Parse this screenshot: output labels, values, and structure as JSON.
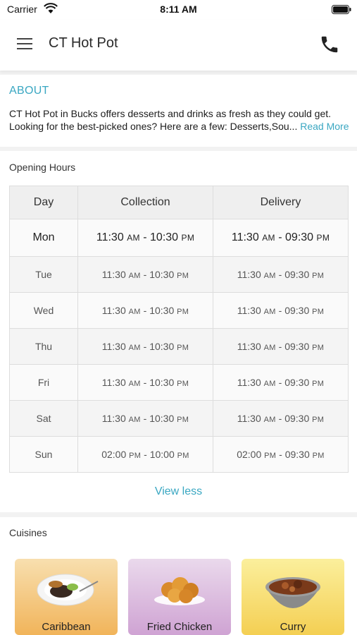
{
  "status_bar": {
    "carrier": "Carrier",
    "time": "8:11 AM"
  },
  "header": {
    "title": "CT Hot Pot",
    "menu_icon": "hamburger-menu-icon",
    "phone_icon": "phone-icon"
  },
  "about": {
    "title": "ABOUT",
    "text": "CT Hot Pot in Bucks offers desserts and drinks as fresh as they could get. Looking for the best-picked ones? Here are a few: Desserts,Sou...",
    "read_more": " Read More"
  },
  "opening_hours": {
    "title": "Opening Hours",
    "headers": {
      "day": "Day",
      "collection": "Collection",
      "delivery": "Delivery"
    },
    "rows": [
      {
        "day": "Mon",
        "collection": {
          "open": "11:30",
          "open_period": "AM",
          "close": "10:30",
          "close_period": "PM"
        },
        "delivery": {
          "open": "11:30",
          "open_period": "AM",
          "close": "09:30",
          "close_period": "PM"
        }
      },
      {
        "day": "Tue",
        "collection": {
          "open": "11:30",
          "open_period": "AM",
          "close": "10:30",
          "close_period": "PM"
        },
        "delivery": {
          "open": "11:30",
          "open_period": "AM",
          "close": "09:30",
          "close_period": "PM"
        }
      },
      {
        "day": "Wed",
        "collection": {
          "open": "11:30",
          "open_period": "AM",
          "close": "10:30",
          "close_period": "PM"
        },
        "delivery": {
          "open": "11:30",
          "open_period": "AM",
          "close": "09:30",
          "close_period": "PM"
        }
      },
      {
        "day": "Thu",
        "collection": {
          "open": "11:30",
          "open_period": "AM",
          "close": "10:30",
          "close_period": "PM"
        },
        "delivery": {
          "open": "11:30",
          "open_period": "AM",
          "close": "09:30",
          "close_period": "PM"
        }
      },
      {
        "day": "Fri",
        "collection": {
          "open": "11:30",
          "open_period": "AM",
          "close": "10:30",
          "close_period": "PM"
        },
        "delivery": {
          "open": "11:30",
          "open_period": "AM",
          "close": "09:30",
          "close_period": "PM"
        }
      },
      {
        "day": "Sat",
        "collection": {
          "open": "11:30",
          "open_period": "AM",
          "close": "10:30",
          "close_period": "PM"
        },
        "delivery": {
          "open": "11:30",
          "open_period": "AM",
          "close": "09:30",
          "close_period": "PM"
        }
      },
      {
        "day": "Sun",
        "collection": {
          "open": "02:00",
          "open_period": "PM",
          "close": "10:00",
          "close_period": "PM"
        },
        "delivery": {
          "open": "02:00",
          "open_period": "PM",
          "close": "09:30",
          "close_period": "PM"
        }
      }
    ],
    "view_less": "View less"
  },
  "cuisines": {
    "title": "Cuisines",
    "items": [
      {
        "label": "Caribbean",
        "icon": "caribbean-dish-icon"
      },
      {
        "label": "Fried Chicken",
        "icon": "fried-chicken-icon"
      },
      {
        "label": "Curry",
        "icon": "curry-bowl-icon"
      }
    ]
  },
  "colors": {
    "accent": "#3aa7c2",
    "background": "#f2f2f2",
    "card_caribbean": "#f1b45a",
    "card_fried_chicken": "#cfa3d3",
    "card_curry": "#f4cf53"
  }
}
